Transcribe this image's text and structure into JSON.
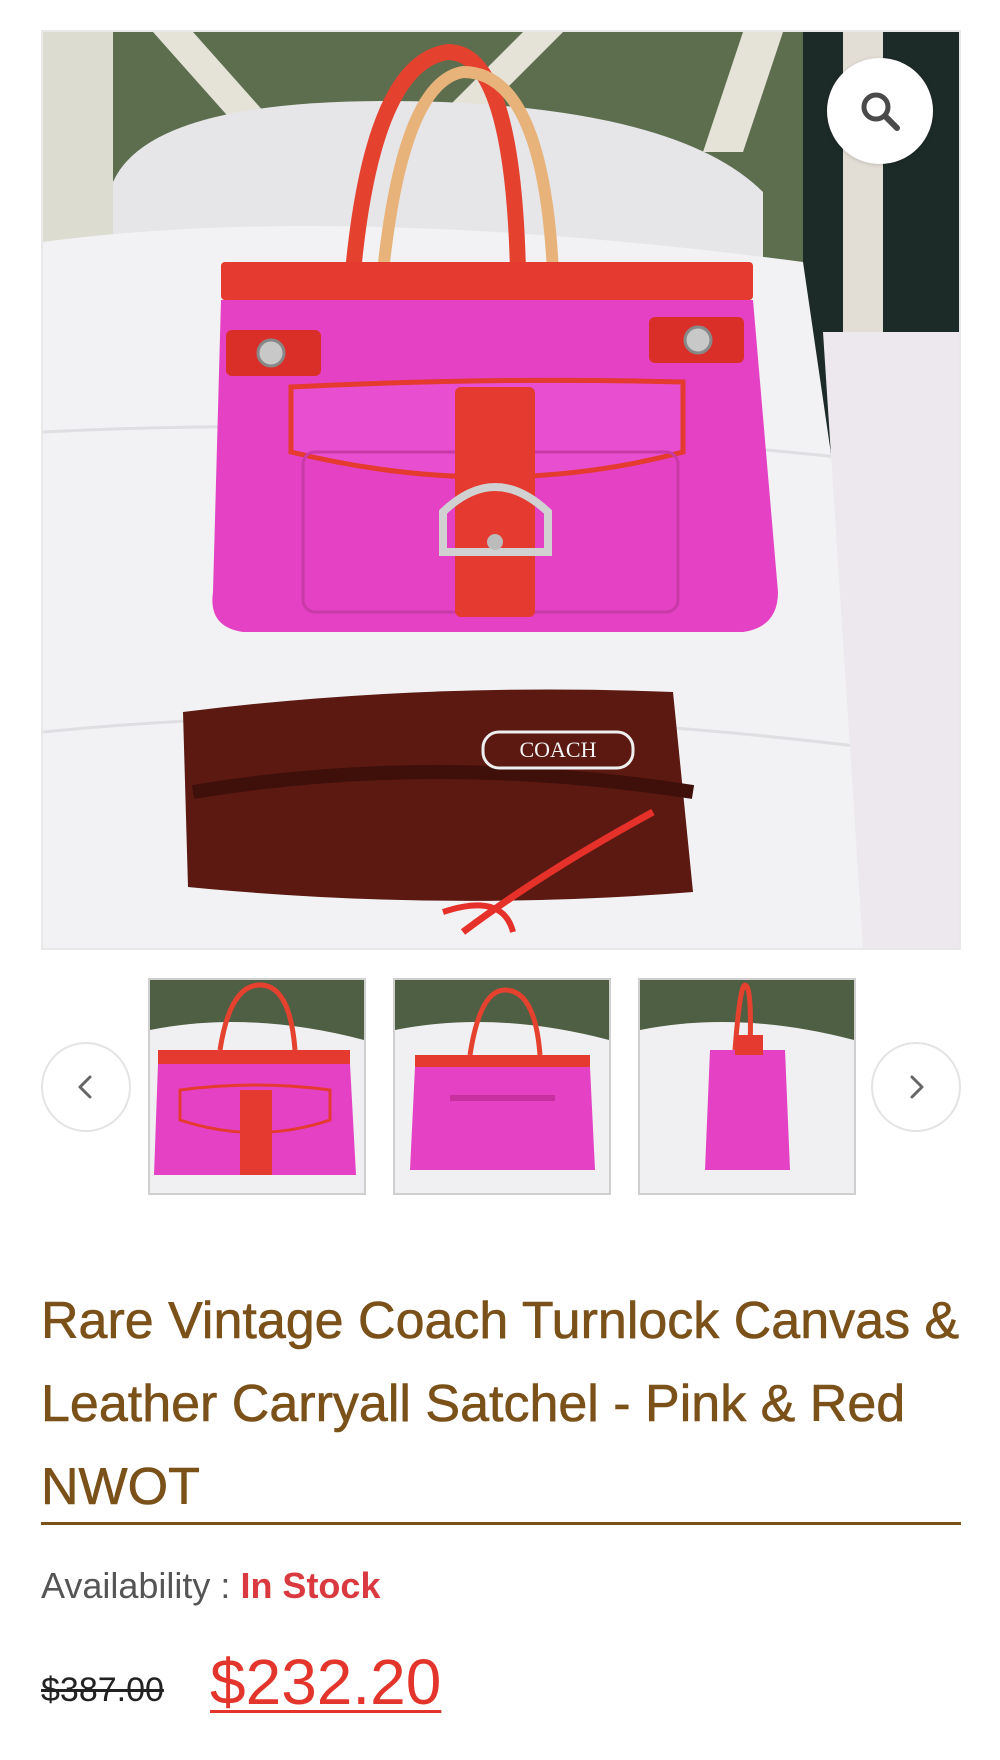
{
  "gallery": {
    "main_image_alt": "",
    "zoom_icon": "search-icon",
    "prev_icon": "chevron-left-icon",
    "next_icon": "chevron-right-icon",
    "thumbnails": [
      "front view",
      "back view",
      "side view"
    ]
  },
  "product": {
    "title": "Rare Vintage Coach Turnlock Canvas & Leather Carryall Satchel - Pink & Red NWOT",
    "availability_label": "Availability : ",
    "availability_value": "In Stock",
    "old_price": "$387.00",
    "sale_price": "$232.20"
  },
  "colors": {
    "title": "#7a5118",
    "in_stock": "#d9393f",
    "sale_price": "#e3352b",
    "bag_pink": "#e43fc4",
    "bag_red": "#e43a2f"
  }
}
